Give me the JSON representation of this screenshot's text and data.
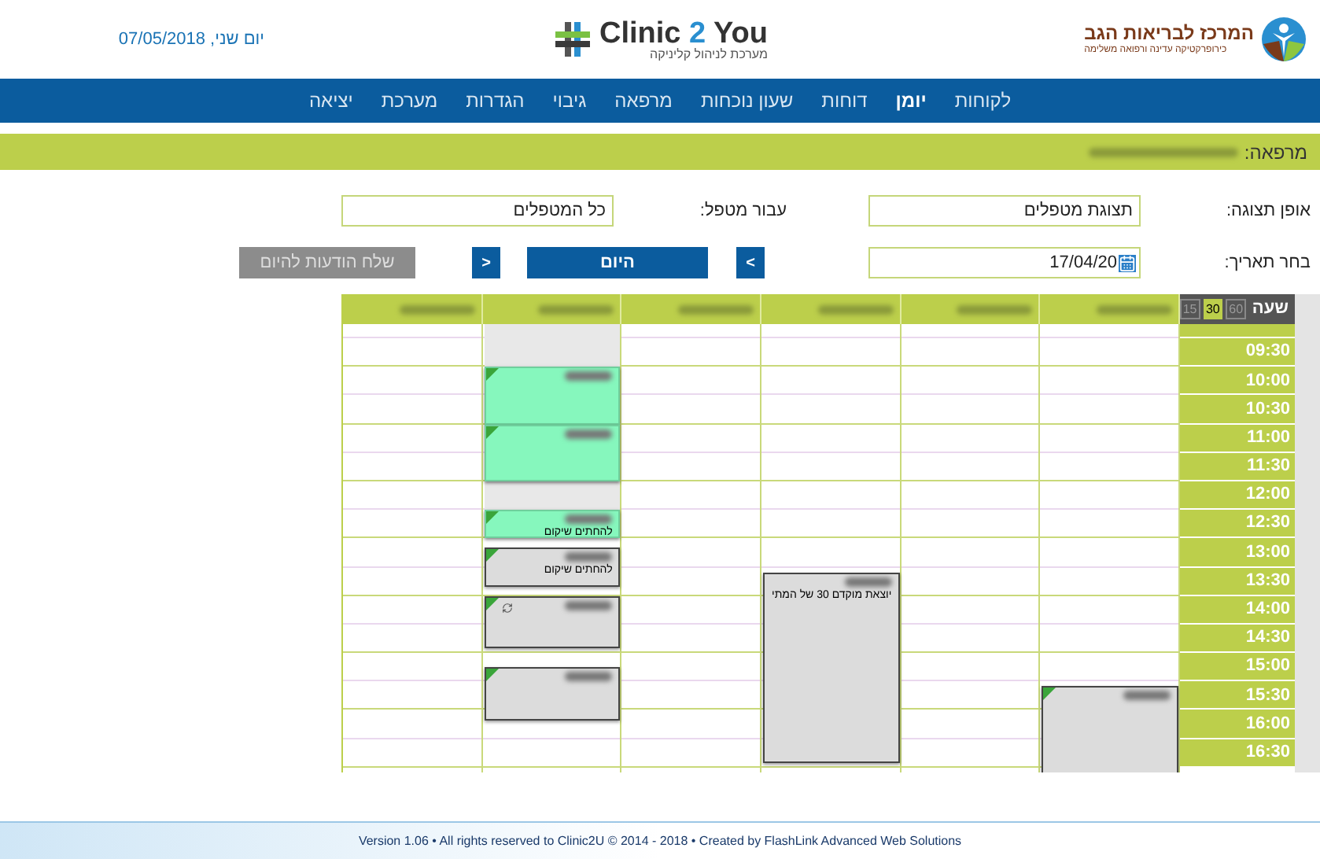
{
  "header": {
    "date": "יום שני, 07/05/2018",
    "app_logo": {
      "name_a": "Clinic ",
      "name_b": "2",
      "name_c": " You",
      "tagline": "מערכת לניהול קליניקה"
    },
    "clinic_logo": {
      "name": "המרכז לבריאות הגב",
      "tagline": "כירופרקטיקה עדינה ורפואה משלימה"
    }
  },
  "nav": [
    {
      "label": "לקוחות",
      "selected": false
    },
    {
      "label": "יומן",
      "selected": true
    },
    {
      "label": "דוחות",
      "selected": false
    },
    {
      "label": "שעון נוכחות",
      "selected": false
    },
    {
      "label": "מרפאה",
      "selected": false
    },
    {
      "label": "גיבוי",
      "selected": false
    },
    {
      "label": "הגדרות",
      "selected": false
    },
    {
      "label": "מערכת",
      "selected": false
    },
    {
      "label": "יציאה",
      "selected": false
    }
  ],
  "breadcrumb": {
    "label": "מרפאה:",
    "redacted": true
  },
  "form": {
    "view_label": "אופן תצוגה:",
    "view_value": "תצוגת מטפלים",
    "therapist_label": "עבור מטפל:",
    "therapist_value": "כל המטפלים",
    "date_label": "בחר תאריך:",
    "date_value": "17/04/20",
    "prev": "<",
    "today": "היום",
    "next": ">",
    "send": "שלח הודעות להיום",
    "send_disabled": true
  },
  "calendar": {
    "hour_label": "שעה",
    "intervals": [
      {
        "label": "60",
        "selected": false
      },
      {
        "label": "30",
        "selected": true
      },
      {
        "label": "15",
        "selected": false
      }
    ],
    "columns": [
      {
        "redacted": true,
        "appointments": [
          {
            "kind": "regular",
            "redacted": true,
            "flagged": true
          }
        ]
      },
      {
        "redacted": true
      },
      {
        "redacted": true,
        "appointments": [
          {
            "kind": "regular",
            "redacted": true,
            "flagged": false,
            "note": "יוצאת מוקדם 30 של המתי"
          }
        ]
      },
      {
        "redacted": true
      },
      {
        "redacted": true,
        "appointments": [
          {
            "kind": "blocked"
          },
          {
            "kind": "highlighted",
            "redacted": true,
            "flagged": true
          },
          {
            "kind": "highlighted",
            "redacted": true,
            "flagged": true
          },
          {
            "kind": "highlighted",
            "redacted": true,
            "flagged": true,
            "note": "להחתים שיקום"
          },
          {
            "kind": "regular",
            "redacted": true,
            "flagged": true,
            "note": "להחתים שיקום"
          },
          {
            "kind": "regular",
            "redacted": true,
            "flagged": true,
            "recurring": true
          },
          {
            "kind": "regular",
            "redacted": true,
            "flagged": true
          }
        ]
      },
      {
        "redacted": true
      }
    ],
    "times": [
      "09:30",
      "10:00",
      "10:30",
      "11:00",
      "11:30",
      "12:00",
      "12:30",
      "13:00",
      "13:30",
      "14:00",
      "14:30",
      "15:00",
      "15:30",
      "16:00",
      "16:30"
    ]
  },
  "footer": "Version 1.06 • All rights reserved to Clinic2U © 2014 - 2018 • Created by FlashLink Advanced Web Solutions"
}
